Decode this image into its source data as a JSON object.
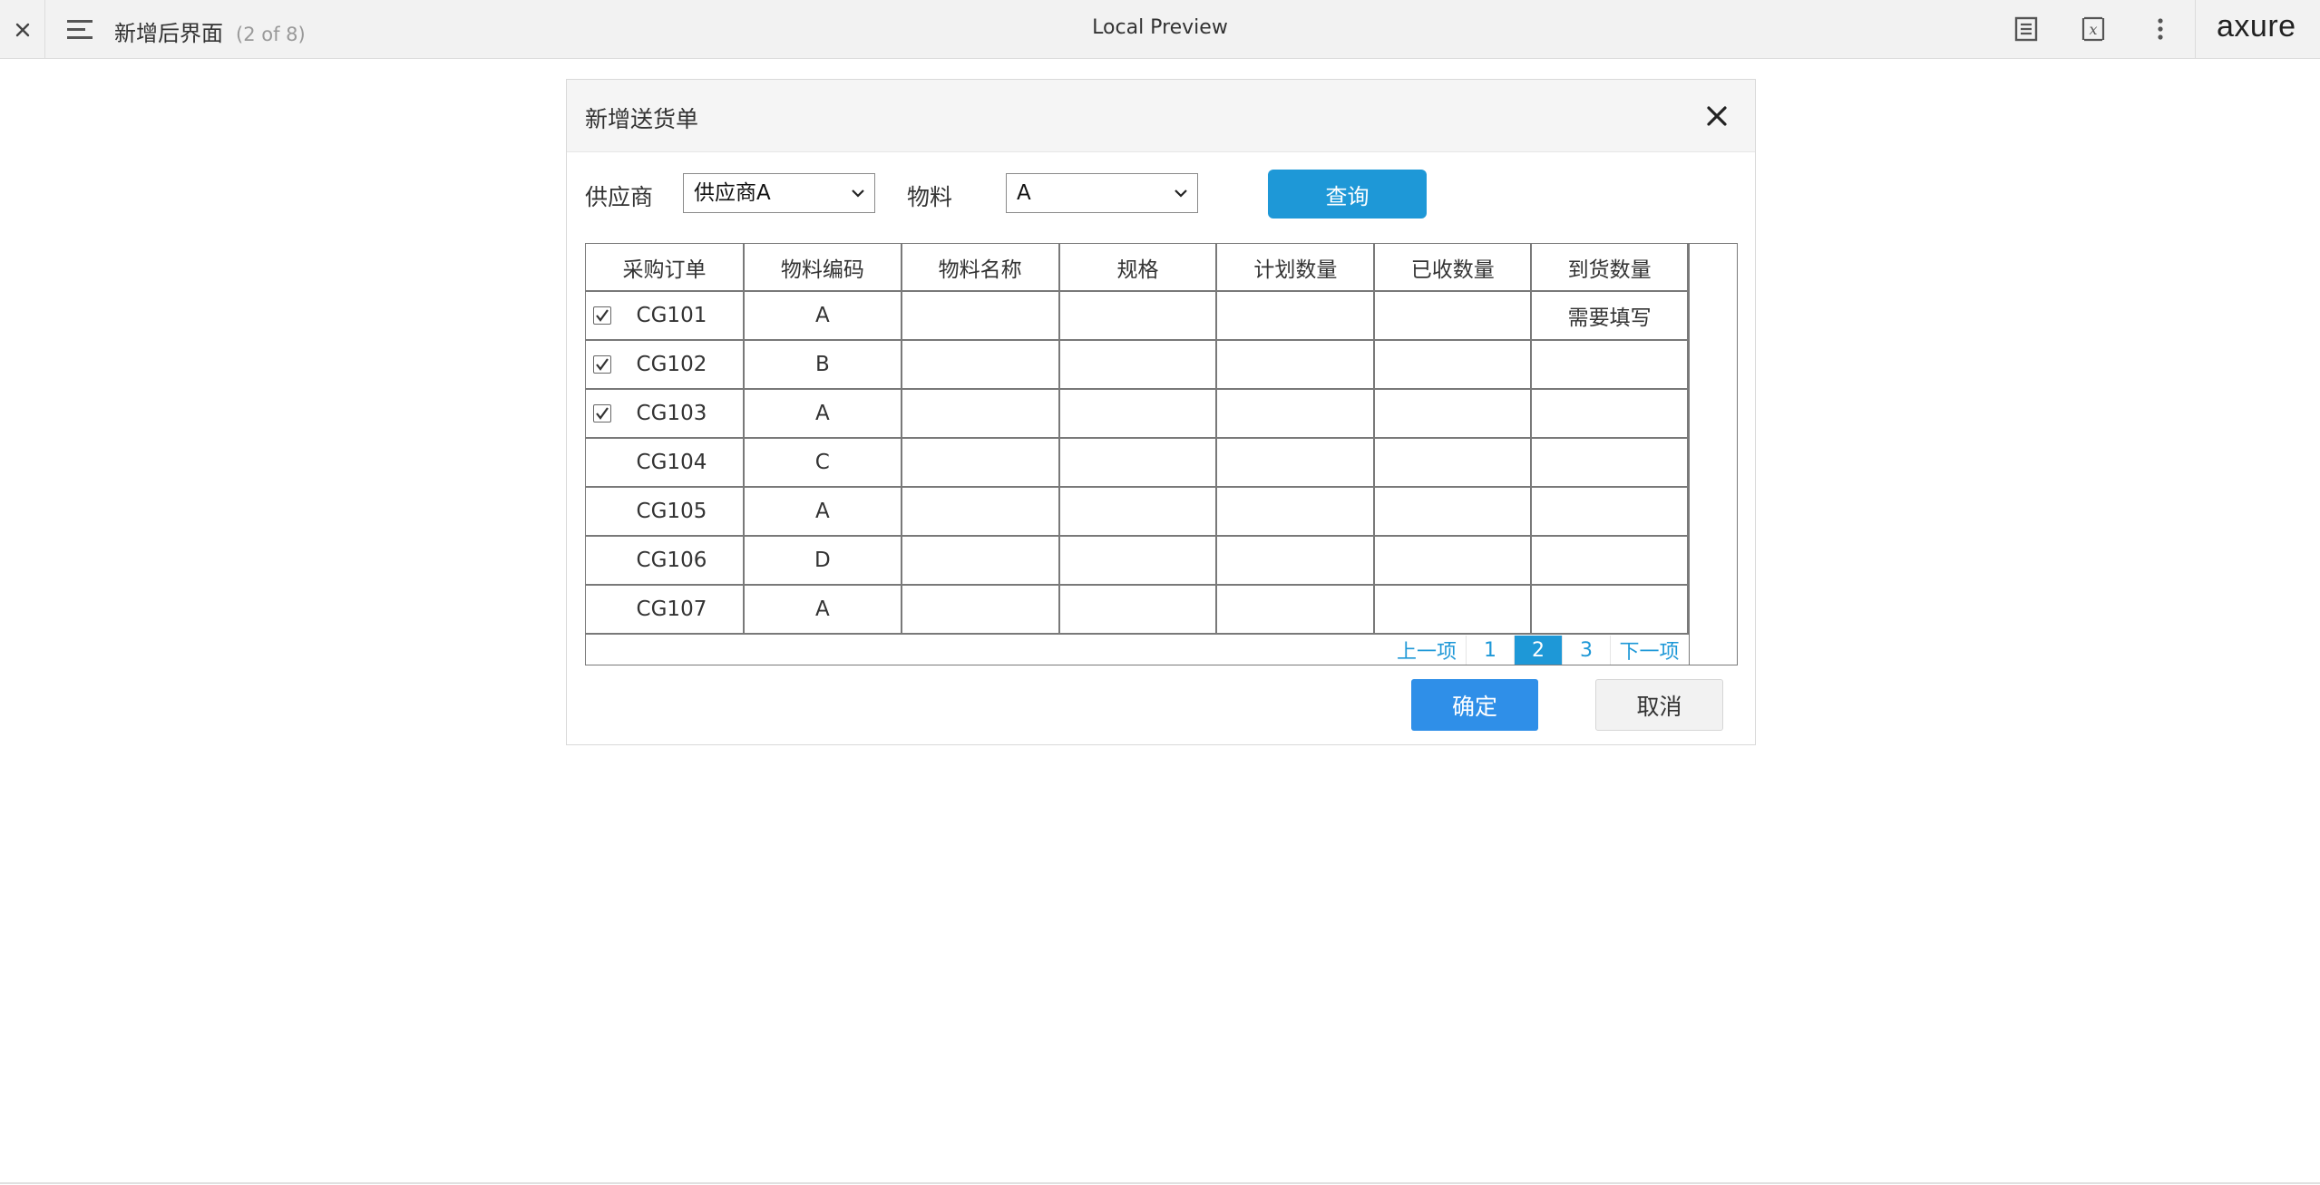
{
  "topbar": {
    "page_title": "新增后界面",
    "page_count": "(2 of 8)",
    "center_label": "Local Preview",
    "logo": "axure"
  },
  "dialog": {
    "title": "新增送货单",
    "supplier_label": "供应商",
    "supplier_value": "供应商A",
    "material_label": "物料",
    "material_value": "A",
    "query_label": "查询",
    "confirm_label": "确定",
    "cancel_label": "取消"
  },
  "table": {
    "headers": [
      "采购订单",
      "物料编码",
      "物料名称",
      "规格",
      "计划数量",
      "已收数量",
      "到货数量"
    ],
    "rows": [
      {
        "checked": true,
        "order": "CG101",
        "code": "A",
        "arrival": "需要填写"
      },
      {
        "checked": true,
        "order": "CG102",
        "code": "B",
        "arrival": ""
      },
      {
        "checked": true,
        "order": "CG103",
        "code": "A",
        "arrival": ""
      },
      {
        "checked": false,
        "order": "CG104",
        "code": "C",
        "arrival": ""
      },
      {
        "checked": false,
        "order": "CG105",
        "code": "A",
        "arrival": ""
      },
      {
        "checked": false,
        "order": "CG106",
        "code": "D",
        "arrival": ""
      },
      {
        "checked": false,
        "order": "CG107",
        "code": "A",
        "arrival": ""
      }
    ]
  },
  "pager": {
    "prev": "上一项",
    "pages": [
      "1",
      "2",
      "3"
    ],
    "current": "2",
    "next": "下一项"
  },
  "colors": {
    "accent": "#1e98d7",
    "confirm": "#2f8fe8",
    "warning": "#d9001b"
  }
}
